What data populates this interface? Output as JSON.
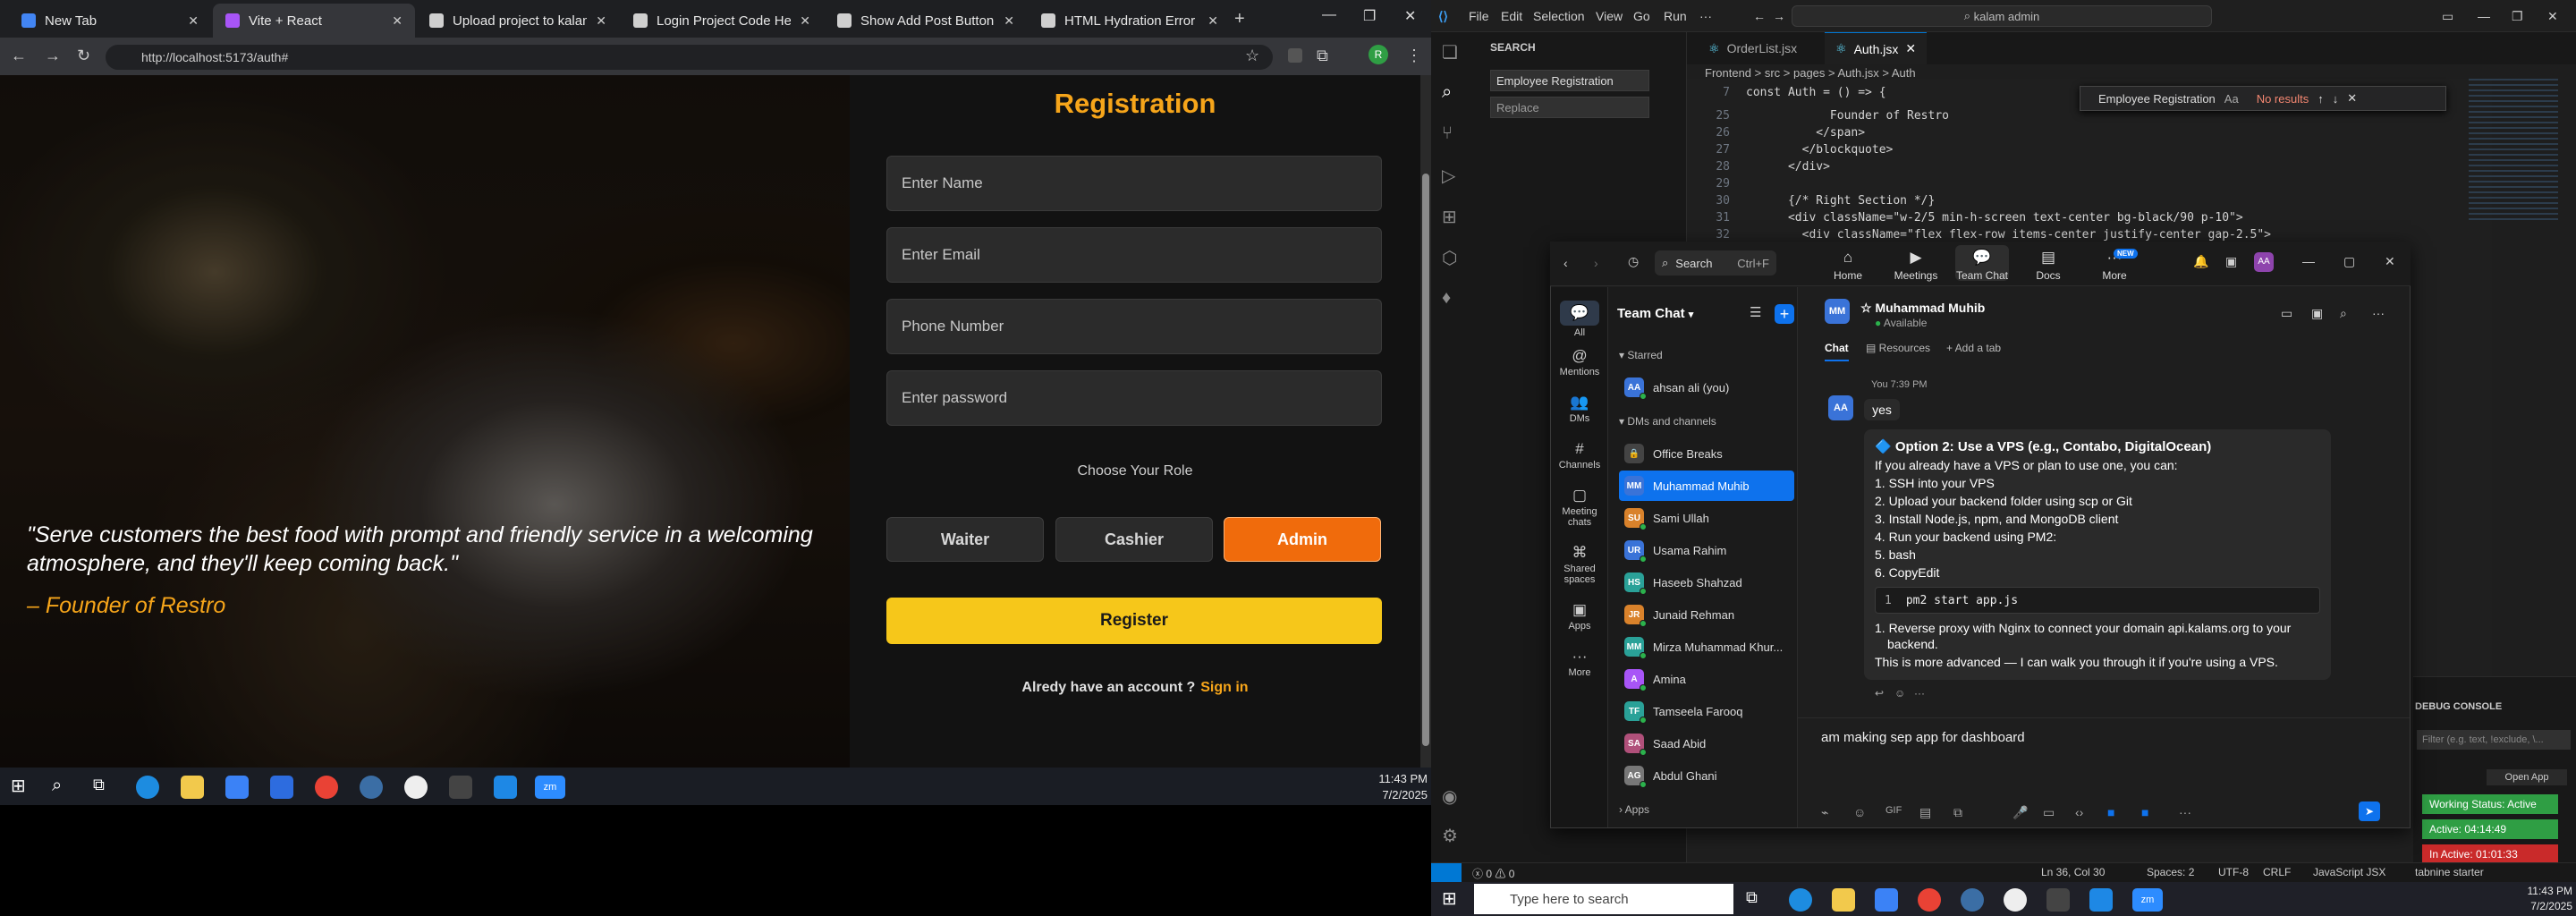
{
  "browser": {
    "tabs": [
      {
        "title": "New Tab",
        "color": "#4285f4"
      },
      {
        "title": "Vite + React",
        "color": "#a855f7"
      },
      {
        "title": "Upload project to kalams.org",
        "color": "#cfcfcf"
      },
      {
        "title": "Login Project Code Help",
        "color": "#cfcfcf"
      },
      {
        "title": "Show Add Post Button",
        "color": "#cfcfcf"
      },
      {
        "title": "HTML Hydration Error Fix",
        "color": "#cfcfcf"
      }
    ],
    "url": "http://localhost:5173/auth#"
  },
  "page": {
    "title": "Registration",
    "name_placeholder": "Enter Name",
    "email_placeholder": "Enter Email",
    "phone_placeholder": "Phone Number",
    "password_placeholder": "Enter password",
    "role_label": "Choose Your Role",
    "roles": [
      "Waiter",
      "Cashier",
      "Admin"
    ],
    "selected_role": "Admin",
    "register_label": "Register",
    "already_text": "Alredy have an account ?",
    "signin_label": "Sign in",
    "quote": "\"Serve customers the best food with prompt and friendly service in a welcoming atmosphere, and they'll keep coming back.\"",
    "founder": "– Founder of Restro"
  },
  "taskbar1": {
    "time": "11:43 PM",
    "date": "7/2/2025"
  },
  "vscode": {
    "menu": [
      "File",
      "Edit",
      "Selection",
      "View",
      "Go",
      "Run"
    ],
    "command_search": "kalam admin",
    "sidebar_title": "SEARCH",
    "search_value": "Employee Registration",
    "replace_placeholder": "Replace",
    "tabs": [
      "OrderList.jsx",
      "Auth.jsx"
    ],
    "breadcrumb": "Frontend > src > pages > Auth.jsx > Auth",
    "find_value": "Employee Registration",
    "find_result": "No results",
    "code_lines": [
      {
        "n": "7",
        "t": "const Auth = () => {"
      },
      {
        "n": "25",
        "t": "            Founder of Restro"
      },
      {
        "n": "26",
        "t": "          </span>"
      },
      {
        "n": "27",
        "t": "        </blockquote>"
      },
      {
        "n": "28",
        "t": "      </div>"
      },
      {
        "n": "29",
        "t": ""
      },
      {
        "n": "30",
        "t": "      {/* Right Section */}"
      },
      {
        "n": "31",
        "t": "      <div className=\"w-2/5 min-h-screen text-center bg-black/90 p-10\">"
      },
      {
        "n": "32",
        "t": "        <div className=\"flex flex-row items-center justify-center gap-2.5\">"
      }
    ],
    "debug_title": "DEBUG CONSOLE",
    "debug_filter": "Filter (e.g. text, !exclude, \\...",
    "open_app": "Open App",
    "work_status": "Working Status: Active",
    "active_time": "Active: 04:14:49",
    "inactive_time": "In Active: 01:01:33",
    "status": {
      "errors": "0",
      "warnings": "0",
      "pos": "Ln 36, Col 30",
      "spaces": "Spaces: 2",
      "enc": "UTF-8",
      "eol": "CRLF",
      "lang": "JavaScript JSX",
      "ext": "tabnine starter"
    }
  },
  "taskbar2": {
    "search": "Type here to search",
    "time": "11:43 PM",
    "date": "7/2/2025"
  },
  "zoom": {
    "search": "Search",
    "shortcut": "Ctrl+F",
    "nav": [
      {
        "label": "Home"
      },
      {
        "label": "Meetings"
      },
      {
        "label": "Team Chat"
      },
      {
        "label": "Docs"
      },
      {
        "label": "More"
      }
    ],
    "new_badge": "NEW",
    "side": [
      "All",
      "Mentions",
      "DMs",
      "Channels",
      "Meeting chats",
      "Shared spaces",
      "Apps",
      "More"
    ],
    "list_title": "Team Chat",
    "starred": "Starred",
    "dms": "DMs and channels",
    "apps_section": "Apps",
    "contacts": [
      {
        "name": "ahsan ali (you)",
        "init": "AA",
        "color": "#3a73d8",
        "on": true
      },
      {
        "name": "Office Breaks",
        "init": "🔒",
        "color": "#444",
        "on": false
      },
      {
        "name": "Muhammad Muhib",
        "init": "MM",
        "color": "#3a73d8",
        "on": false
      },
      {
        "name": "Sami Ullah",
        "init": "SU",
        "color": "#d9822b",
        "on": true
      },
      {
        "name": "Usama Rahim",
        "init": "UR",
        "color": "#3a73d8",
        "on": true
      },
      {
        "name": "Haseeb Shahzad",
        "init": "HS",
        "color": "#2aa198",
        "on": true
      },
      {
        "name": "Junaid Rehman",
        "init": "JR",
        "color": "#d9822b",
        "on": true
      },
      {
        "name": "Mirza Muhammad Khur...",
        "init": "MM",
        "color": "#2aa198",
        "on": true
      },
      {
        "name": "Amina",
        "init": "A",
        "color": "#a855f7",
        "on": true
      },
      {
        "name": "Tamseela Farooq",
        "init": "TF",
        "color": "#2aa198",
        "on": true
      },
      {
        "name": "Saad Abid",
        "init": "SA",
        "color": "#b0507a",
        "on": true
      },
      {
        "name": "Abdul Ghani",
        "init": "AG",
        "color": "#777",
        "on": true
      }
    ],
    "chat_name": "Muhammad Muhib",
    "chat_status": "Available",
    "chat_tabs": [
      "Chat",
      "Resources",
      "+ Add a tab"
    ],
    "msg_time": "You 7:39 PM",
    "msg_text": "yes",
    "option_title": "🔷 Option 2: Use a VPS (e.g., Contabo, DigitalOcean)",
    "option_intro": "If you already have a VPS or plan to use one, you can:",
    "option_steps": [
      "1. SSH into your VPS",
      "2. Upload your backend folder using scp or Git",
      "3. Install Node.js, npm, and MongoDB client",
      "4. Run your backend using PM2:",
      "5. bash",
      "6. CopyEdit"
    ],
    "code_num": "1",
    "code_text": "pm2 start app.js",
    "after_step": "1. Reverse proxy with Nginx to connect your domain api.kalams.org to your",
    "after_step2": "backend.",
    "after_note": "This is more advanced — I can walk you through it if you're using a VPS.",
    "compose_text": "am making sep app for dashboard",
    "avatar_init": "AA",
    "chat_avatar_init": "MM"
  }
}
